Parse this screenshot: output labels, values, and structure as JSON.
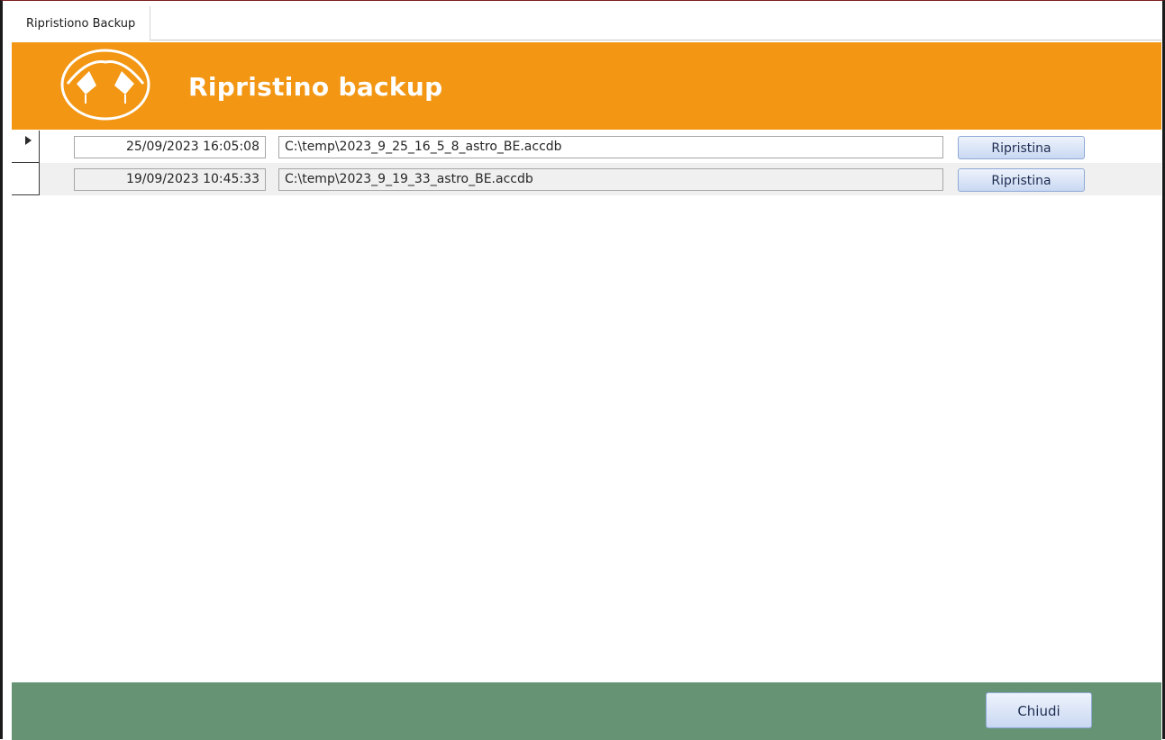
{
  "window": {
    "tab_label": "Ripristiono Backup"
  },
  "header": {
    "title": "Ripristino backup",
    "logo_icon": "tent-flags-logo-icon",
    "background_color": "#f29613"
  },
  "backups": [
    {
      "date": "25/09/2023 16:05:08",
      "path": "C:\\temp\\2023_9_25_16_5_8_astro_BE.accdb",
      "restore_label": "Ripristina",
      "current": true
    },
    {
      "date": "19/09/2023 10:45:33",
      "path": "C:\\temp\\2023_9_19_33_astro_BE.accdb",
      "restore_label": "Ripristina",
      "current": false
    }
  ],
  "footer": {
    "close_label": "Chiudi",
    "background_color": "#659374"
  }
}
